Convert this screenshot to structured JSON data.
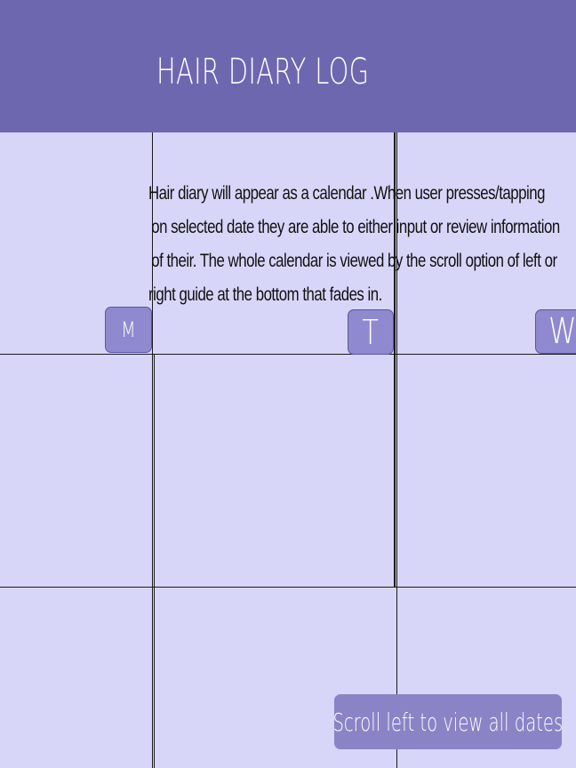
{
  "header": {
    "title": "HAIR DIARY LOG"
  },
  "calendar": {
    "days": [
      "M",
      "T",
      "W"
    ],
    "note_lines": [
      "Hair diary will appear as a calendar .When user presses/tapping",
      "on selected date they are able to either input or review information",
      "of their. The whole calendar is viewed by the scroll option of left or",
      "right guide at the bottom that fades in."
    ]
  },
  "scroll_hint": {
    "label": "Scroll left to view all dates"
  },
  "colors": {
    "header_bg": "#6d67b0",
    "page_bg": "#d8d6f8",
    "button_bg": "#8f89cf",
    "text_dark": "#111111"
  }
}
